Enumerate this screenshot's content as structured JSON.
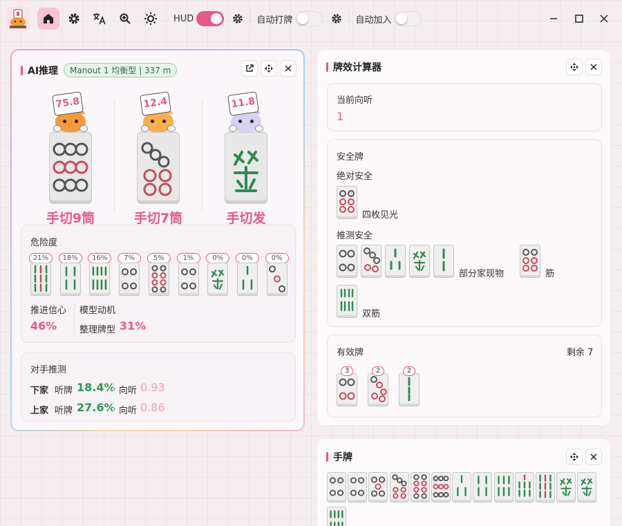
{
  "toolbar": {
    "hud_label": "HUD",
    "hud_on": true,
    "auto_discard_label": "自动打牌",
    "auto_discard_on": false,
    "auto_join_label": "自动加入",
    "auto_join_on": false
  },
  "ai_panel": {
    "title": "AI推理",
    "model_pill": "Manout 1 均衡型 | 337 m",
    "recommendations": [
      {
        "score": "75.8",
        "label": "手切9筒",
        "tile": "9p"
      },
      {
        "score": "12.4",
        "label": "手切7筒",
        "tile": "7p"
      },
      {
        "score": "11.8",
        "label": "手切发",
        "tile": "green-dragon"
      }
    ],
    "danger": {
      "title": "危险度",
      "tiles": [
        {
          "pct": "21%",
          "tile": "9s"
        },
        {
          "pct": "18%",
          "tile": "4s"
        },
        {
          "pct": "16%",
          "tile": "8s"
        },
        {
          "pct": "7%",
          "tile": "4p"
        },
        {
          "pct": "5%",
          "tile": "8p"
        },
        {
          "pct": "1%",
          "tile": "4p"
        },
        {
          "pct": "0%",
          "tile": "green-dragon"
        },
        {
          "pct": "0%",
          "tile": "3s"
        },
        {
          "pct": "0%",
          "tile": "3p"
        }
      ]
    },
    "confidence_label": "推进信心",
    "confidence_value": "46%",
    "motive_label": "模型动机",
    "motive_sub": "整理牌型",
    "motive_value": "31%",
    "opponents": {
      "title": "对手推测",
      "rows": [
        {
          "name": "下家",
          "tenpai_label": "听牌",
          "tenpai": "18.4%",
          "shanten_label": "向听",
          "shanten": "0.93"
        },
        {
          "name": "上家",
          "tenpai_label": "听牌",
          "tenpai": "27.6%",
          "shanten_label": "向听",
          "shanten": "0.86"
        }
      ]
    }
  },
  "calc_panel": {
    "title": "牌效计算器",
    "shanten_label": "当前向听",
    "shanten_value": "1",
    "safe_title": "安全牌",
    "absolute_label": "绝对安全",
    "absolute_note": "四枚见光",
    "inferred_label": "推测安全",
    "inferred_note": "部分家现物",
    "suji_note": "筋",
    "double_suji_note": "双筋",
    "effective_title": "有效牌",
    "remaining": "剩余 7",
    "effective": [
      {
        "count": "3",
        "tile": "4p"
      },
      {
        "count": "2",
        "tile": "5p"
      },
      {
        "count": "2",
        "tile": "3s"
      }
    ]
  },
  "hand_panel": {
    "title": "手牌",
    "tiles": [
      "4p",
      "4p",
      "5p",
      "7p",
      "8p",
      "9p",
      "3s",
      "4s",
      "6s",
      "7s",
      "9s",
      "green-dragon",
      "green-dragon",
      "8s"
    ]
  }
}
